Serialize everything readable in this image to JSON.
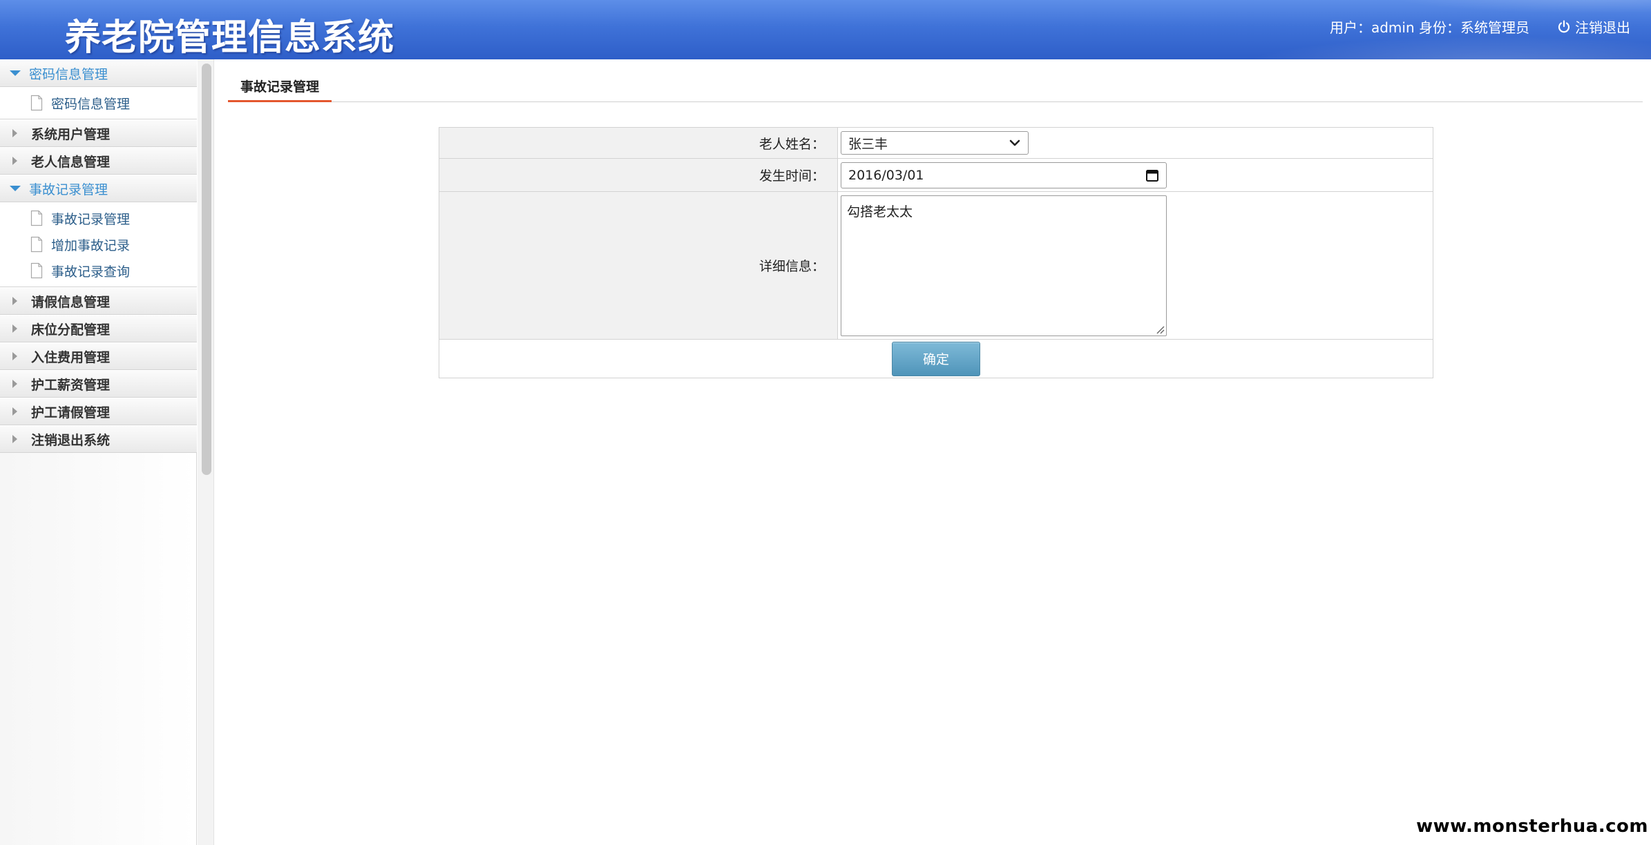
{
  "header": {
    "title": "养老院管理信息系统",
    "user_label": "用户：admin 身份：系统管理员",
    "logout_label": "注销退出"
  },
  "sidebar": {
    "groups": [
      {
        "label": "密码信息管理",
        "open": true,
        "items": [
          {
            "label": "密码信息管理"
          }
        ]
      },
      {
        "label": "系统用户管理",
        "open": false
      },
      {
        "label": "老人信息管理",
        "open": false
      },
      {
        "label": "事故记录管理",
        "open": true,
        "items": [
          {
            "label": "事故记录管理"
          },
          {
            "label": "增加事故记录"
          },
          {
            "label": "事故记录查询"
          }
        ]
      },
      {
        "label": "请假信息管理",
        "open": false
      },
      {
        "label": "床位分配管理",
        "open": false
      },
      {
        "label": "入住费用管理",
        "open": false
      },
      {
        "label": "护工薪资管理",
        "open": false
      },
      {
        "label": "护工请假管理",
        "open": false
      },
      {
        "label": "注销退出系统",
        "open": false
      }
    ]
  },
  "main": {
    "tab_label": "事故记录管理",
    "form": {
      "elder_name_label": "老人姓名：",
      "elder_name_value": "张三丰",
      "time_label": "发生时间：",
      "time_value": "2016/03/01",
      "detail_label": "详细信息：",
      "detail_value": "勾搭老太太",
      "submit_label": "确定"
    }
  },
  "watermark": "www.monsterhua.com",
  "colors": {
    "header_blue": "#3f72d8",
    "menu_active": "#3a8fd0",
    "tab_underline": "#e4572e",
    "button": "#5d9fc2"
  }
}
